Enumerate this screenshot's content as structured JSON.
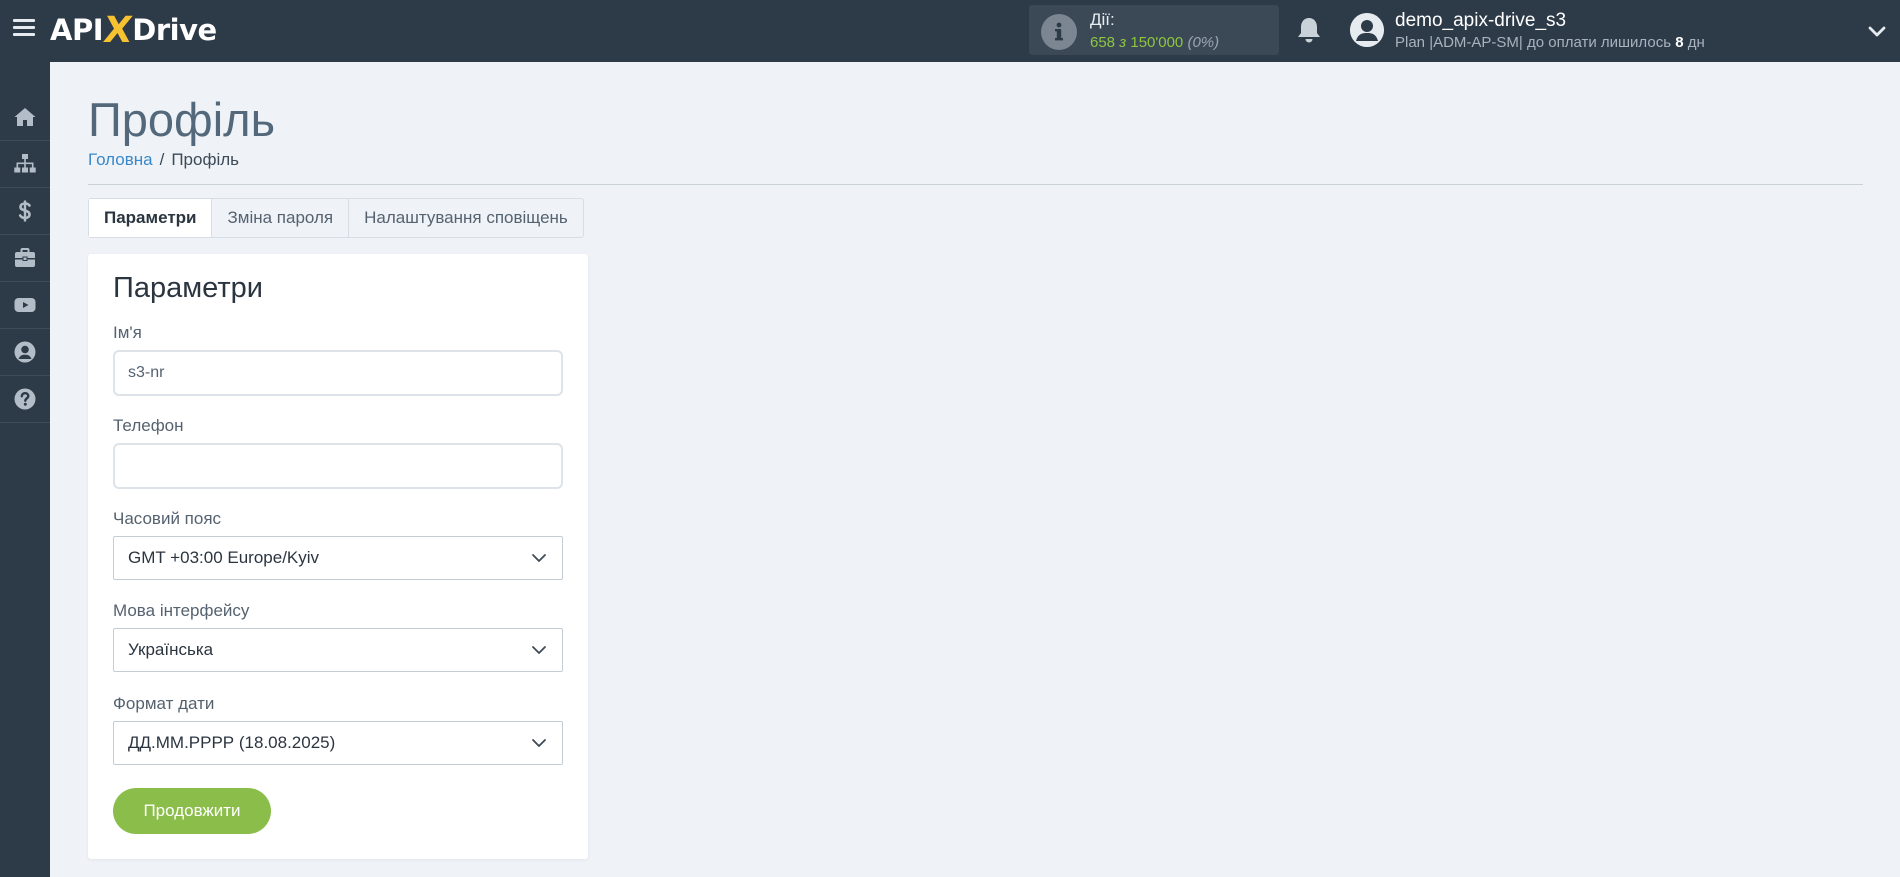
{
  "header": {
    "logo": {
      "part1": "API",
      "x": "X",
      "part2": "Drive"
    },
    "actions": {
      "label": "Дії:",
      "used": "658",
      "sep": "з",
      "total": "150'000",
      "percent": "(0%)"
    },
    "user": {
      "name": "demo_apix-drive_s3",
      "plan_prefix": "Plan |ADM-AP-SM| до оплати лишилось",
      "days": "8",
      "days_unit": "дн"
    }
  },
  "sidebar": {
    "items": [
      {
        "icon": "home-icon"
      },
      {
        "icon": "sitemap-icon"
      },
      {
        "icon": "dollar-icon"
      },
      {
        "icon": "briefcase-icon"
      },
      {
        "icon": "youtube-icon"
      },
      {
        "icon": "user-circle-icon"
      },
      {
        "icon": "question-circle-icon"
      }
    ]
  },
  "page": {
    "title": "Профіль",
    "breadcrumb": {
      "home": "Головна",
      "separator": "/",
      "current": "Профіль"
    }
  },
  "tabs": [
    {
      "label": "Параметри",
      "active": true
    },
    {
      "label": "Зміна пароля",
      "active": false
    },
    {
      "label": "Налаштування сповіщень",
      "active": false
    }
  ],
  "form": {
    "title": "Параметри",
    "name": {
      "label": "Ім'я",
      "value": "s3-nr"
    },
    "phone": {
      "label": "Телефон",
      "value": ""
    },
    "timezone": {
      "label": "Часовий пояс",
      "value": "GMT +03:00 Europe/Kyiv"
    },
    "language": {
      "label": "Мова інтерфейсу",
      "value": "Українська"
    },
    "date_format": {
      "label": "Формат дати",
      "value": "ДД.ММ.РРРР (18.08.2025)"
    },
    "submit": "Продовжити"
  },
  "colors": {
    "topbar": "#2d3a48",
    "accent_green": "#8bbd4a",
    "link_blue": "#3a88c7",
    "background": "#eff3f8"
  }
}
